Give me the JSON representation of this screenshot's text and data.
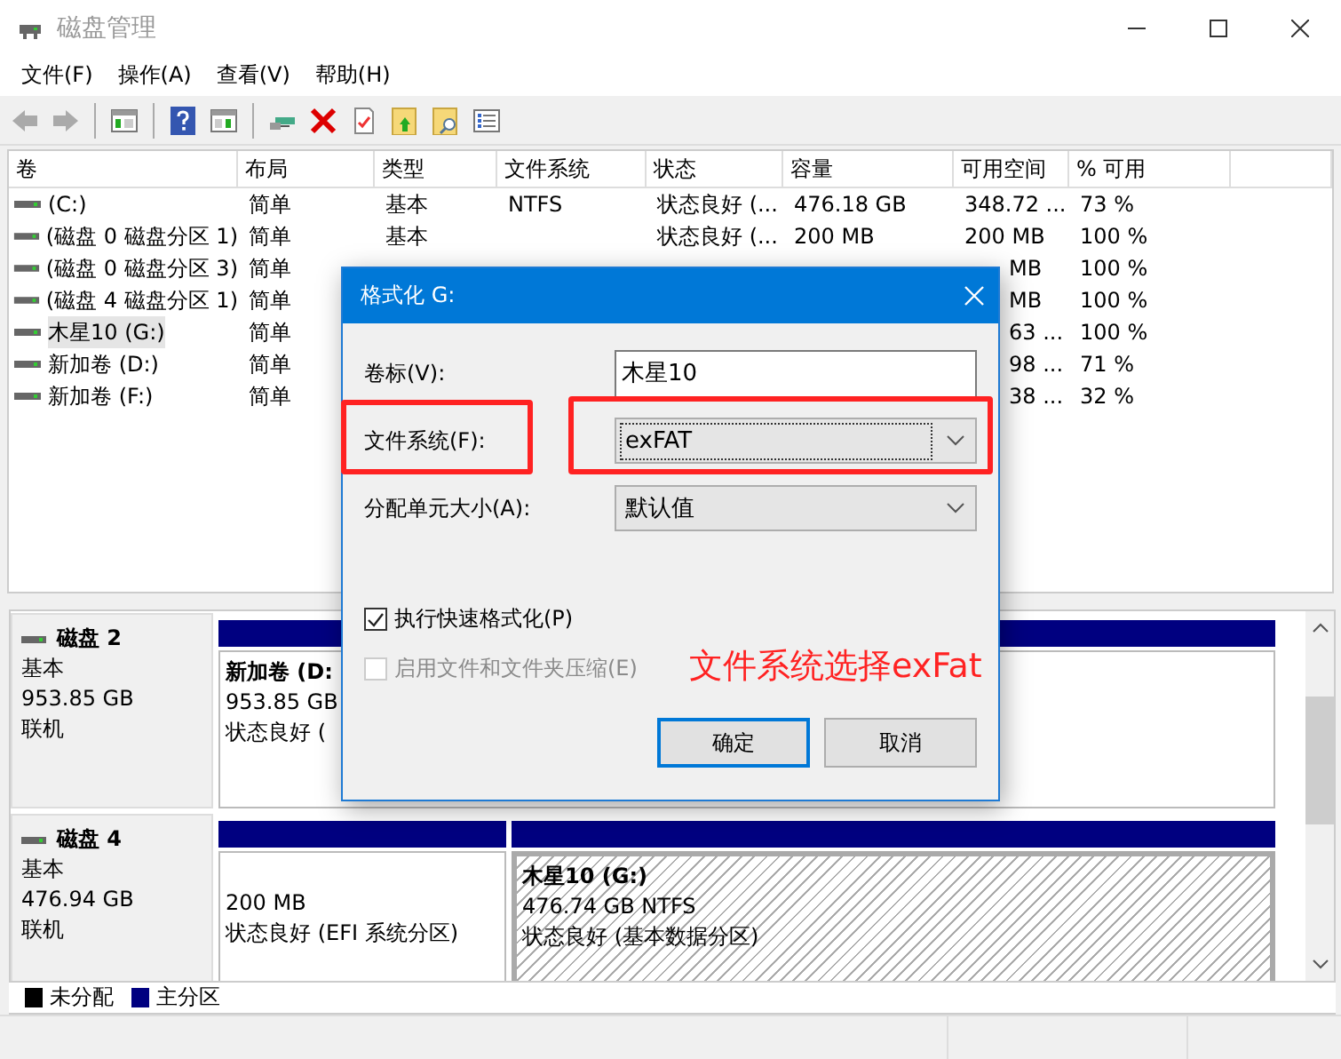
{
  "window": {
    "title": "磁盘管理"
  },
  "menu": [
    "文件(F)",
    "操作(A)",
    "查看(V)",
    "帮助(H)"
  ],
  "volume_table": {
    "columns": [
      "卷",
      "布局",
      "类型",
      "文件系统",
      "状态",
      "容量",
      "可用空间",
      "% 可用"
    ],
    "rows": [
      {
        "selected": false,
        "cells": [
          "(C:)",
          "简单",
          "基本",
          "NTFS",
          "状态良好 (...",
          "476.18 GB",
          "348.72 ...",
          "73 %"
        ]
      },
      {
        "selected": false,
        "cells": [
          "(磁盘 0 磁盘分区 1)",
          "简单",
          "基本",
          null,
          "状态良好 (...",
          "200 MB",
          "200 MB",
          "100 %"
        ]
      },
      {
        "selected": false,
        "cells": [
          "(磁盘 0 磁盘分区 3)",
          "简单",
          null,
          null,
          null,
          null,
          {
            "text": "MB",
            "covered": true
          },
          "100 %"
        ]
      },
      {
        "selected": false,
        "cells": [
          "(磁盘 4 磁盘分区 1)",
          "简单",
          null,
          null,
          null,
          null,
          {
            "text": "MB",
            "covered": true
          },
          "100 %"
        ]
      },
      {
        "selected": true,
        "cells": [
          "木星10 (G:)",
          "简单",
          null,
          null,
          null,
          null,
          {
            "text": "63 ...",
            "covered": true
          },
          "100 %"
        ]
      },
      {
        "selected": false,
        "cells": [
          "新加卷 (D:)",
          "简单",
          null,
          null,
          null,
          null,
          {
            "text": "98 ...",
            "covered": true
          },
          "71 %"
        ]
      },
      {
        "selected": false,
        "cells": [
          "新加卷 (F:)",
          "简单",
          null,
          null,
          null,
          null,
          {
            "text": "38 ...",
            "covered": true
          },
          "32 %"
        ]
      }
    ]
  },
  "disks": [
    {
      "name": "磁盘 2",
      "type": "基本",
      "size": "953.85 GB",
      "status": "联机",
      "partitions": [
        {
          "kind": "primary",
          "selected": false,
          "title": "新加卷 (D:",
          "lines": [
            "953.85 GB",
            "状态良好 ("
          ]
        }
      ]
    },
    {
      "name": "磁盘 4",
      "type": "基本",
      "size": "476.94 GB",
      "status": "联机",
      "partitions": [
        {
          "kind": "primary",
          "selected": false,
          "lines": [
            "200 MB",
            "状态良好 (EFI 系统分区)"
          ]
        },
        {
          "kind": "primary",
          "selected": true,
          "title": "木星10 (G:)",
          "lines": [
            "476.74 GB NTFS",
            "状态良好 (基本数据分区)"
          ]
        }
      ]
    }
  ],
  "legend": [
    {
      "label": "未分配",
      "color": "#000000"
    },
    {
      "label": "主分区",
      "color": "#000080"
    }
  ],
  "dialog": {
    "title": "格式化 G:",
    "fields": [
      {
        "kind": "text",
        "label": "卷标(V):",
        "value": "木星10"
      },
      {
        "kind": "dropdown",
        "label": "文件系统(F):",
        "value": "exFAT",
        "focused": true
      },
      {
        "kind": "dropdown",
        "label": "分配单元大小(A):",
        "value": "默认值",
        "focused": false
      }
    ],
    "checkboxes": [
      {
        "label": "执行快速格式化(P)",
        "checked": true,
        "disabled": false
      },
      {
        "label": "启用文件和文件夹压缩(E)",
        "checked": false,
        "disabled": true
      }
    ],
    "buttons": [
      {
        "label": "确定",
        "default": true
      },
      {
        "label": "取消",
        "default": false
      }
    ],
    "annotation": "文件系统选择exFat"
  }
}
